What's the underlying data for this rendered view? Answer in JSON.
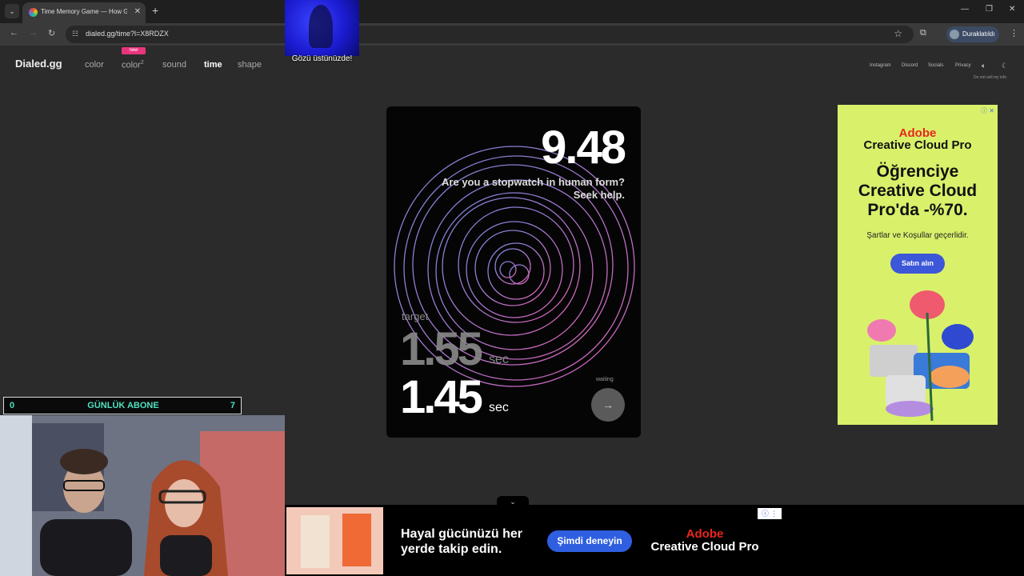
{
  "browser": {
    "tab_title": "Time Memory Game — How G",
    "url": "dialed.gg/time?l=X8RDZX",
    "profile_label": "Duraklatıldı",
    "icons": {
      "tab_search": "chevron-down-icon",
      "close": "close-icon",
      "new_tab": "plus-icon",
      "back": "arrow-left-icon",
      "forward": "arrow-right-icon",
      "reload": "reload-icon",
      "site_info": "tune-icon",
      "bookmark": "star-icon",
      "extensions": "puzzle-icon",
      "menu": "kebab-icon"
    }
  },
  "overlay": {
    "caption": "Gözü üstünüzde!"
  },
  "site": {
    "logo": "Dialed.gg",
    "nav": [
      {
        "label": "color"
      },
      {
        "label": "color",
        "sup": "2"
      },
      {
        "label": "sound"
      },
      {
        "label": "time"
      },
      {
        "label": "shape"
      }
    ],
    "active_nav": "time",
    "new_badge": "new",
    "right_links": [
      "Instagram",
      "Discord",
      "Socials",
      "Privacy"
    ],
    "do_not_sell": "Do not sell my info",
    "icons": {
      "sound": "speaker-icon",
      "theme": "moon-icon"
    }
  },
  "game": {
    "score": "9.48",
    "message_line1": "Are you a stopwatch in human form?",
    "message_line2": "Seek help.",
    "target_label": "target",
    "target_value": "1.55",
    "target_unit": "sec",
    "result_value": "1.45",
    "result_unit": "sec",
    "status": "waiting",
    "next_icon": "arrow-right-icon"
  },
  "ad_right": {
    "brand": "Adobe",
    "product": "Creative Cloud Pro",
    "headline_line1": "Öğrenciye",
    "headline_line2": "Creative Cloud",
    "headline_line3": "Pro'da -%70.",
    "legal": "Şartlar ve Koşullar geçerlidir.",
    "cta": "Satın alın",
    "background": "#d9f06b",
    "accent": "#e8271c",
    "button_color": "#3c57d8"
  },
  "subscriber_bar": {
    "left": "0",
    "title": "GÜNLÜK ABONE",
    "right": "7",
    "color": "#4fe0c0"
  },
  "ad_bottom": {
    "text_line1": "Hayal gücünüzü her",
    "text_line2": "yerde takip edin.",
    "cta": "Şimdi deneyin",
    "brand": "Adobe",
    "product": "Creative Cloud Pro"
  }
}
